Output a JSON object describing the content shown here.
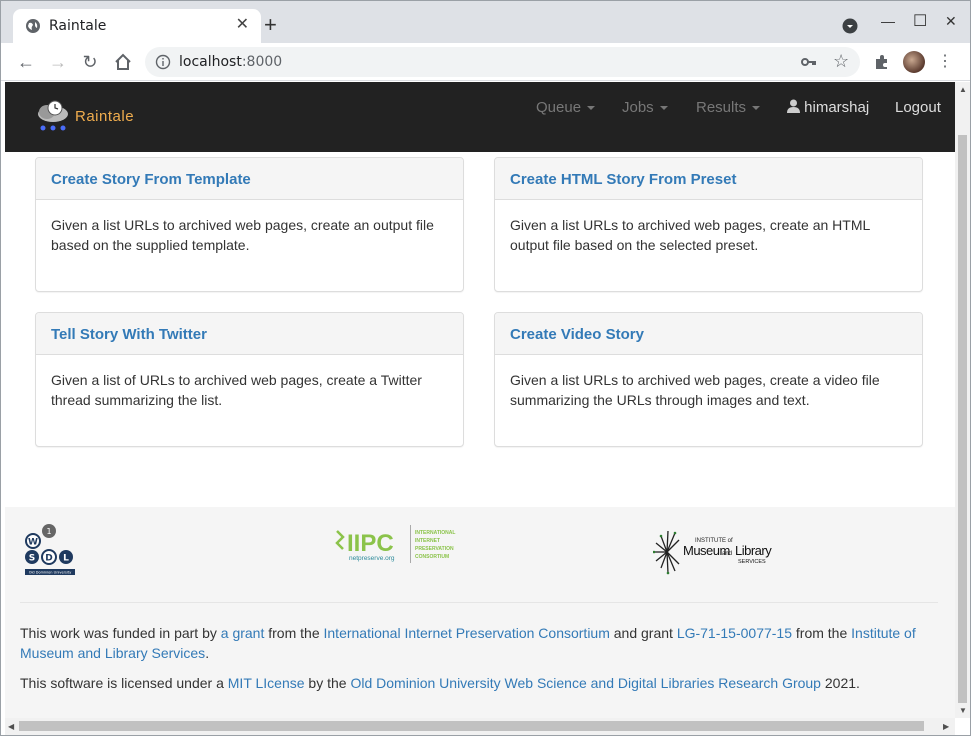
{
  "browser": {
    "tab_title": "Raintale",
    "url_host": "localhost",
    "url_port": ":8000"
  },
  "navbar": {
    "brand": "Raintale",
    "menus": [
      {
        "label": "Queue"
      },
      {
        "label": "Jobs"
      },
      {
        "label": "Results"
      }
    ],
    "user": "himarshaj",
    "logout": "Logout"
  },
  "cards": [
    {
      "title": "Create Story From Template",
      "body": "Given a list URLs to archived web pages, create an output file based on the supplied template."
    },
    {
      "title": "Create HTML Story From Preset",
      "body": "Given a list URLs to archived web pages, create an HTML output file based on the selected preset."
    },
    {
      "title": "Tell Story With Twitter",
      "body": "Given a list of URLs to archived web pages, create a Twitter thread summarizing the list."
    },
    {
      "title": "Create Video Story",
      "body": "Given a list URLs to archived web pages, create a video file summarizing the URLs through images and text."
    }
  ],
  "footer": {
    "logos": {
      "wsdl": {
        "w": "W",
        "s": "S",
        "d": "D",
        "l": "L",
        "caption": "Old Dominion University"
      },
      "iipc": {
        "name": "IIPC",
        "sub": "netpreserve.org",
        "lines": [
          "INTERNATIONAL",
          "INTERNET",
          "PRESERVATION",
          "CONSORTIUM"
        ]
      },
      "imls": {
        "top": "INSTITUTE of",
        "main": "Museum",
        "and": "and",
        "main2": "Library",
        "bottom": "SERVICES"
      }
    },
    "funding": {
      "t1": "This work was funded in part by ",
      "l1": "a grant",
      "t2": " from the ",
      "l2": "International Internet Preservation Consortium",
      "t3": " and grant ",
      "l3": "LG-71-15-0077-15",
      "t4": " from the ",
      "l4": "Institute of Museum and Library Services",
      "t5": "."
    },
    "license": {
      "t1": "This software is licensed under a ",
      "l1": "MIT LIcense",
      "t2": " by the ",
      "l2": "Old Dominion University Web Science and Digital Libraries Research Group",
      "t3": " 2021."
    }
  }
}
